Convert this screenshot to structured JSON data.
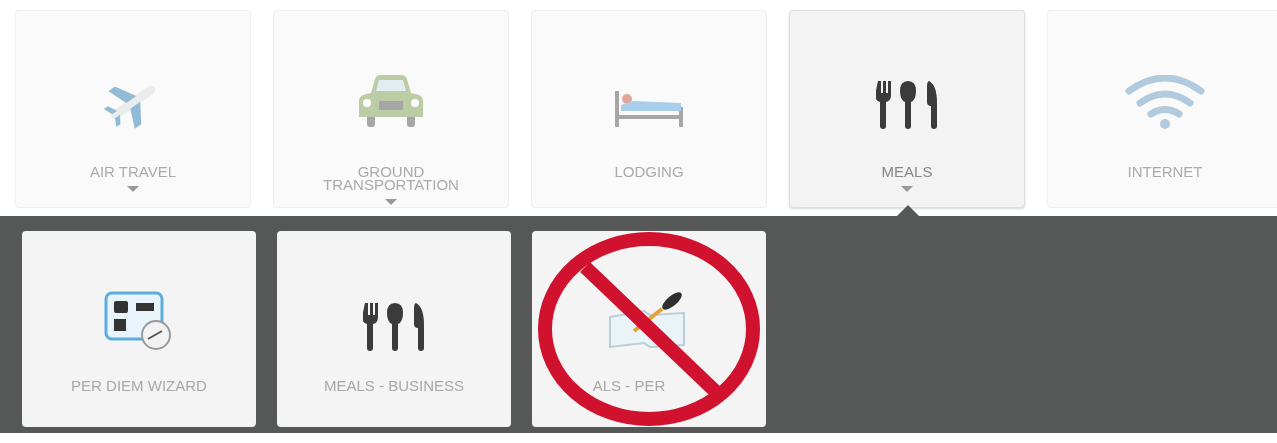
{
  "categories": [
    {
      "label": "AIR TRAVEL",
      "selected": false,
      "expandable": true
    },
    {
      "label": "GROUND TRANSPORTATION",
      "selected": false,
      "expandable": true
    },
    {
      "label": "LODGING",
      "selected": false,
      "expandable": false
    },
    {
      "label": "MEALS",
      "selected": true,
      "expandable": true
    },
    {
      "label": "INTERNET",
      "selected": false,
      "expandable": false
    }
  ],
  "submenu": [
    {
      "label": "PER DIEM WIZARD",
      "blocked": false
    },
    {
      "label": "MEALS - BUSINESS",
      "blocked": false
    },
    {
      "label": "ALS - PER",
      "blocked": true
    }
  ]
}
